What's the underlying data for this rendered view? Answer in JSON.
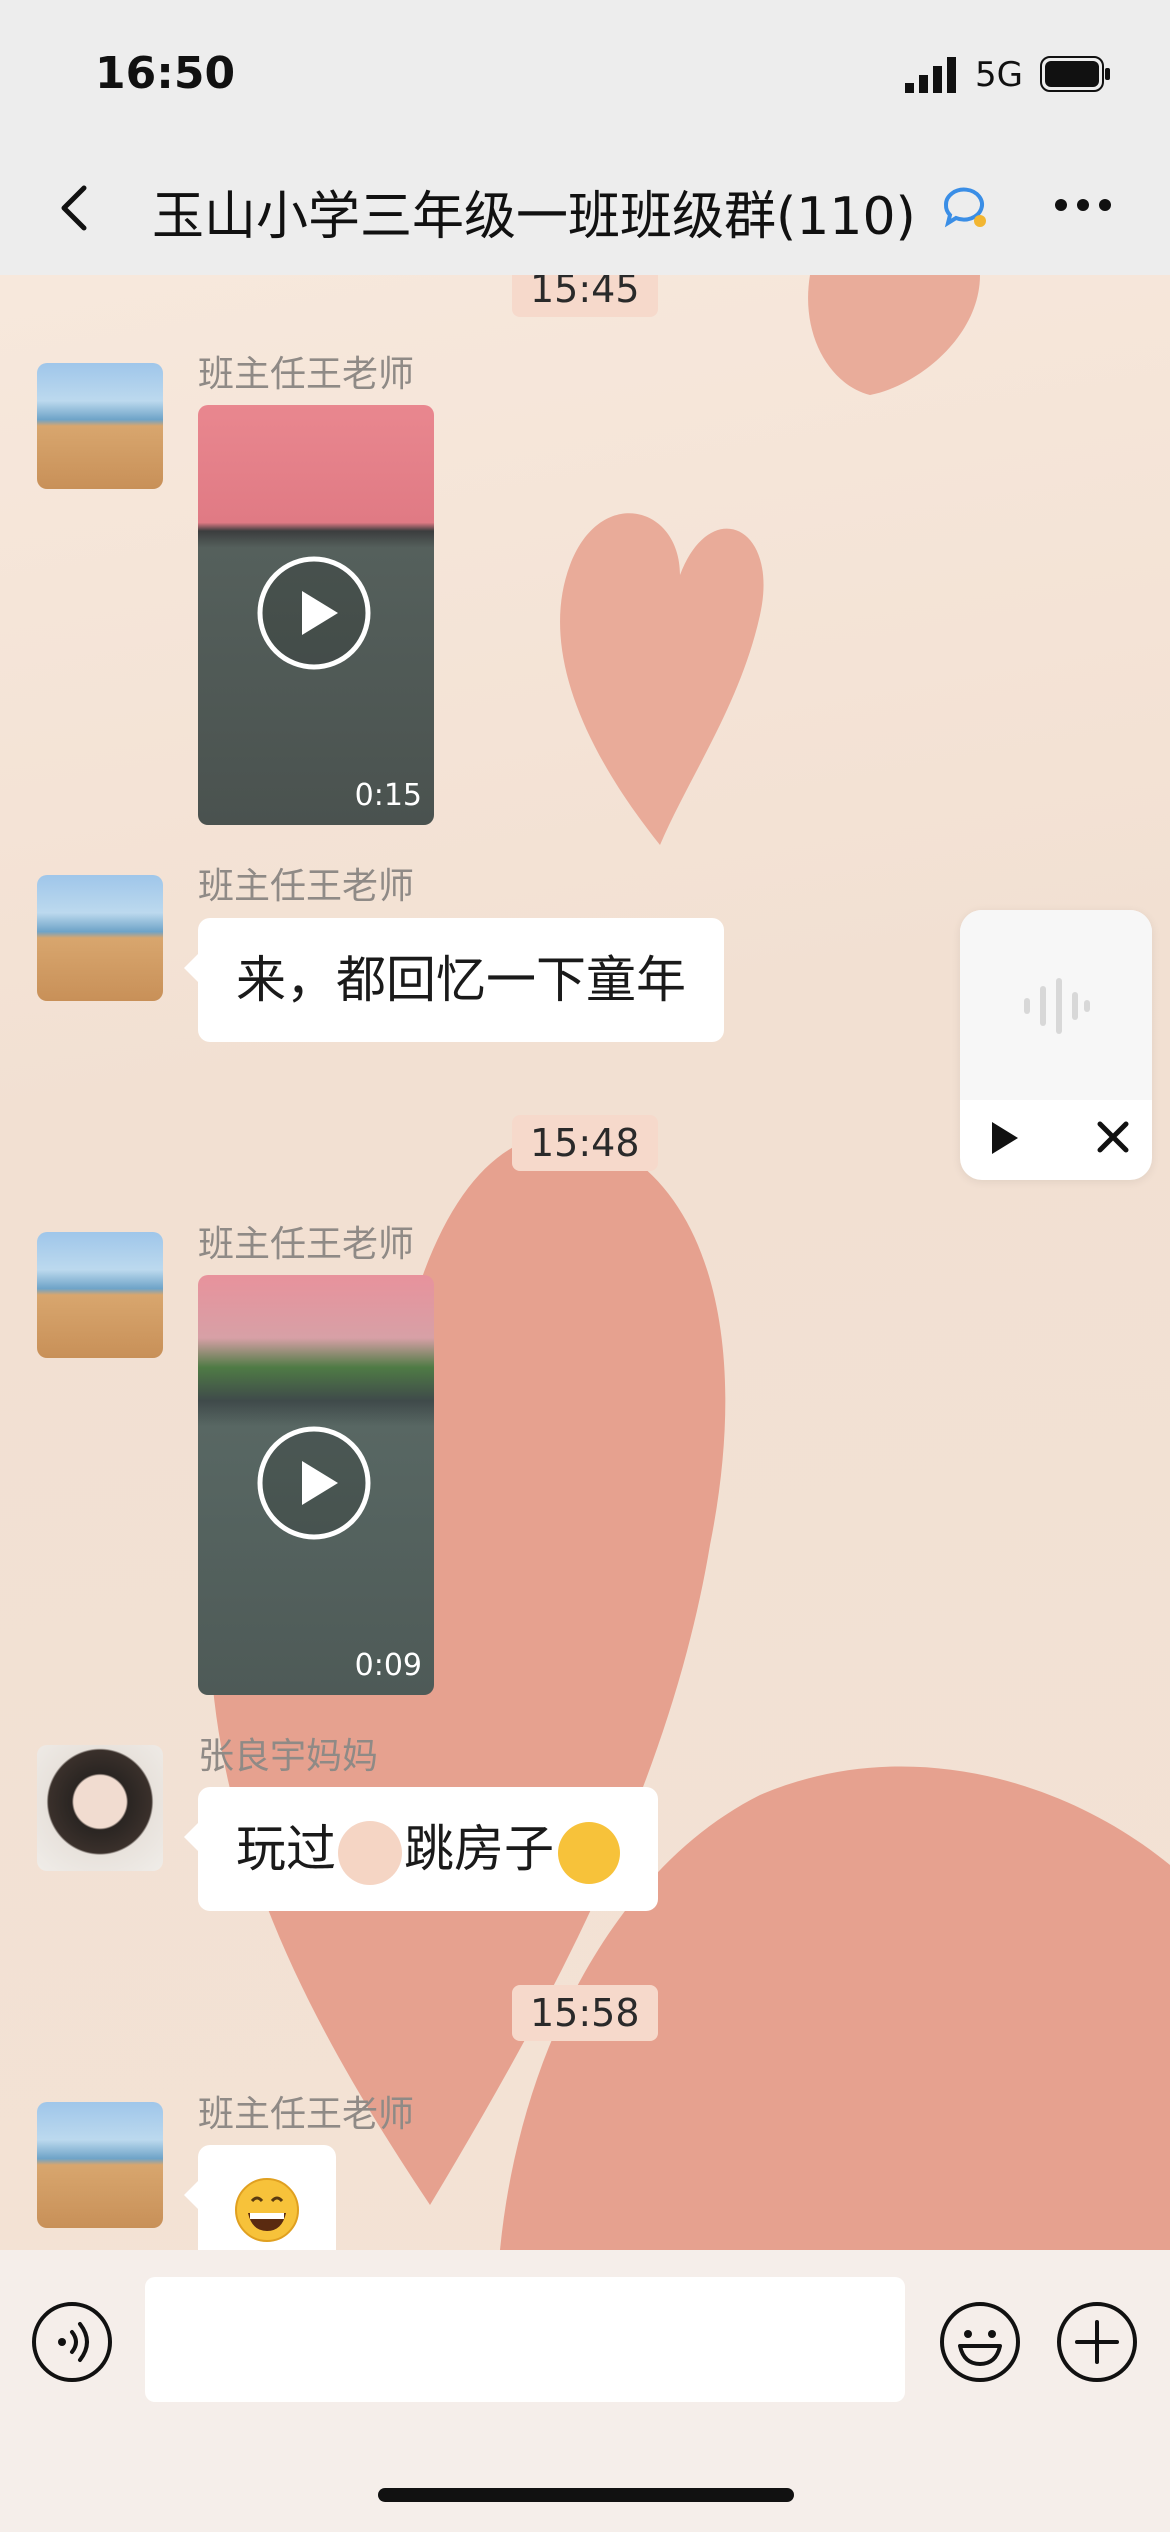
{
  "status_bar": {
    "time": "16:50",
    "network": "5G"
  },
  "nav": {
    "title": "玉山小学三年级一班班级群(110)"
  },
  "messages": {
    "time_top": "15:45",
    "m1": {
      "sender": "班主任王老师",
      "video_duration": "0:15"
    },
    "m2": {
      "sender": "班主任王老师",
      "text": "来，都回忆一下童年"
    },
    "time2": "15:48",
    "m3": {
      "sender": "班主任王老师",
      "video_duration": "0:09"
    },
    "m4": {
      "sender": "张良宇妈妈",
      "text_a": "玩过",
      "text_b": "跳房子"
    },
    "time3": "15:58",
    "m5": {
      "sender": "班主任王老师"
    }
  },
  "colors": {
    "bubble": "#ffffff",
    "time_chip": "#f6d9cb",
    "heart": "#e49a87",
    "nav_bg": "#ededed"
  },
  "icons": [
    "back-icon",
    "chat-bubble-icon",
    "more-icon",
    "play-icon",
    "voice-icon",
    "emoji-icon",
    "plus-icon",
    "waveform-icon",
    "close-icon"
  ]
}
